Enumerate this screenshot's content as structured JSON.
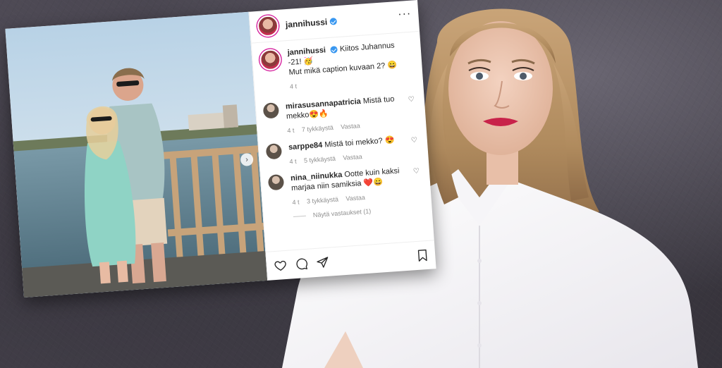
{
  "post": {
    "username": "jannihussi",
    "caption_line1": "Kiitos Juhannus -21! 🥳",
    "caption_line2": "Mut mikä caption kuvaan 2? 😄",
    "caption_time": "4 t",
    "more_label": "···"
  },
  "comments": [
    {
      "user": "mirasusannapatricia",
      "text": "Mistä tuo mekko😍🔥",
      "time": "4 t",
      "likes": "7 tykkäystä",
      "reply": "Vastaa"
    },
    {
      "user": "sarppe84",
      "text": "Mistä toi mekko? 😍",
      "time": "4 t",
      "likes": "5 tykkäystä",
      "reply": "Vastaa"
    },
    {
      "user": "nina_niinukka",
      "text": "Ootte kuin kaksi marjaa niin samiksia ❤️😄",
      "time": "4 t",
      "likes": "3 tykkäystä",
      "reply": "Vastaa",
      "view_replies": "Näytä vastaukset (1)"
    }
  ],
  "icons": {
    "like": "heart-icon",
    "comment": "comment-icon",
    "share": "send-icon",
    "save": "bookmark-icon",
    "verified": "verified-badge-icon",
    "carousel": "chevron-right-icon"
  },
  "colors": {
    "verified": "#3897f0",
    "lipstick": "#c8234a",
    "text_dark": "#262626",
    "text_meta": "#8e8e8e"
  }
}
